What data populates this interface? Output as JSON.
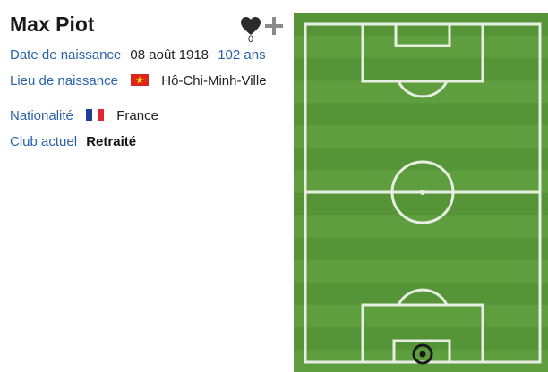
{
  "player": {
    "name": "Max Piot",
    "likes": "0"
  },
  "info": {
    "birth_date_label": "Date de naissance",
    "birth_date": "08 août 1918",
    "age": "102 ans",
    "birth_place_label": "Lieu de naissance",
    "birth_place": "Hô-Chi-Minh-Ville",
    "birth_place_flag": "vietnam-flag",
    "nationality_label": "Nationalité",
    "nationality": "France",
    "nationality_flag": "france-flag",
    "club_label": "Club actuel",
    "club": "Retraité"
  },
  "pitch": {
    "grass_light": "#5f9e3e",
    "grass_dark": "#4f8d33",
    "line_color": "#e8eee4",
    "position_marker": "goalkeeper-position-icon"
  }
}
